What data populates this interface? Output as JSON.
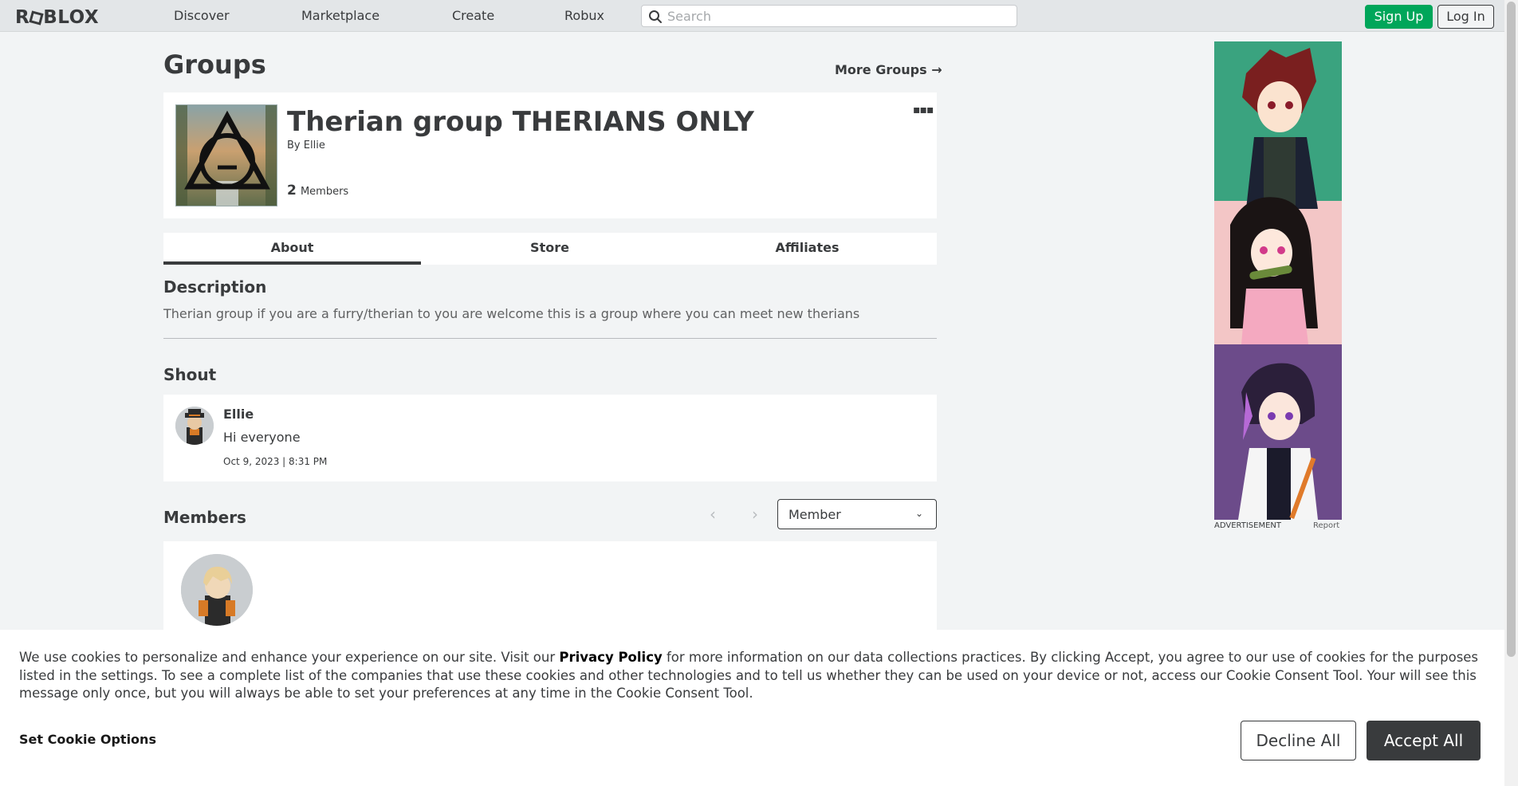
{
  "header": {
    "logo_text": "ROBLOX",
    "nav": [
      "Discover",
      "Marketplace",
      "Create",
      "Robux"
    ],
    "search_placeholder": "Search",
    "signup_label": "Sign Up",
    "login_label": "Log In"
  },
  "page": {
    "title": "Groups",
    "more_groups_label": "More Groups",
    "more_groups_arrow": "→"
  },
  "group": {
    "name": "Therian group THERIANS ONLY",
    "by_prefix": "By",
    "owner": "Ellie",
    "member_count": "2",
    "member_label": "Members",
    "more_menu_glyph": "▪▪▪"
  },
  "tabs": [
    {
      "label": "About",
      "active": true
    },
    {
      "label": "Store",
      "active": false
    },
    {
      "label": "Affiliates",
      "active": false
    }
  ],
  "about": {
    "description_heading": "Description",
    "description": "Therian group if you are a furry/therian to you are welcome this is a group where you can meet new therians",
    "shout_heading": "Shout",
    "shout": {
      "user": "Ellie",
      "message": "Hi everyone",
      "date": "Oct 9, 2023 | 8:31 PM"
    },
    "members_heading": "Members",
    "pager_prev": "‹",
    "pager_next": "›",
    "role_selected": "Member",
    "role_chevron": "⌄"
  },
  "ad": {
    "label": "ADVERTISEMENT",
    "report": "Report"
  },
  "cookie": {
    "text_before": "We use cookies to personalize and enhance your experience on our site. Visit our ",
    "privacy_link": "Privacy Policy",
    "text_after": " for more information on our data collections practices. By clicking Accept, you agree to our use of cookies for the purposes listed in the settings. To see a complete list of the companies that use these cookies and other technologies and to tell us whether they can be used on your device or not, access our Cookie Consent Tool. Your will see this message only once, but you will always be able to set your preferences at any time in the Cookie Consent Tool.",
    "set_options": "Set Cookie Options",
    "decline": "Decline All",
    "accept": "Accept All"
  },
  "colors": {
    "signup_green": "#00a65a",
    "page_bg": "#f2f4f5",
    "text_dark": "#393b3d",
    "accept_bg": "#393b3d"
  }
}
